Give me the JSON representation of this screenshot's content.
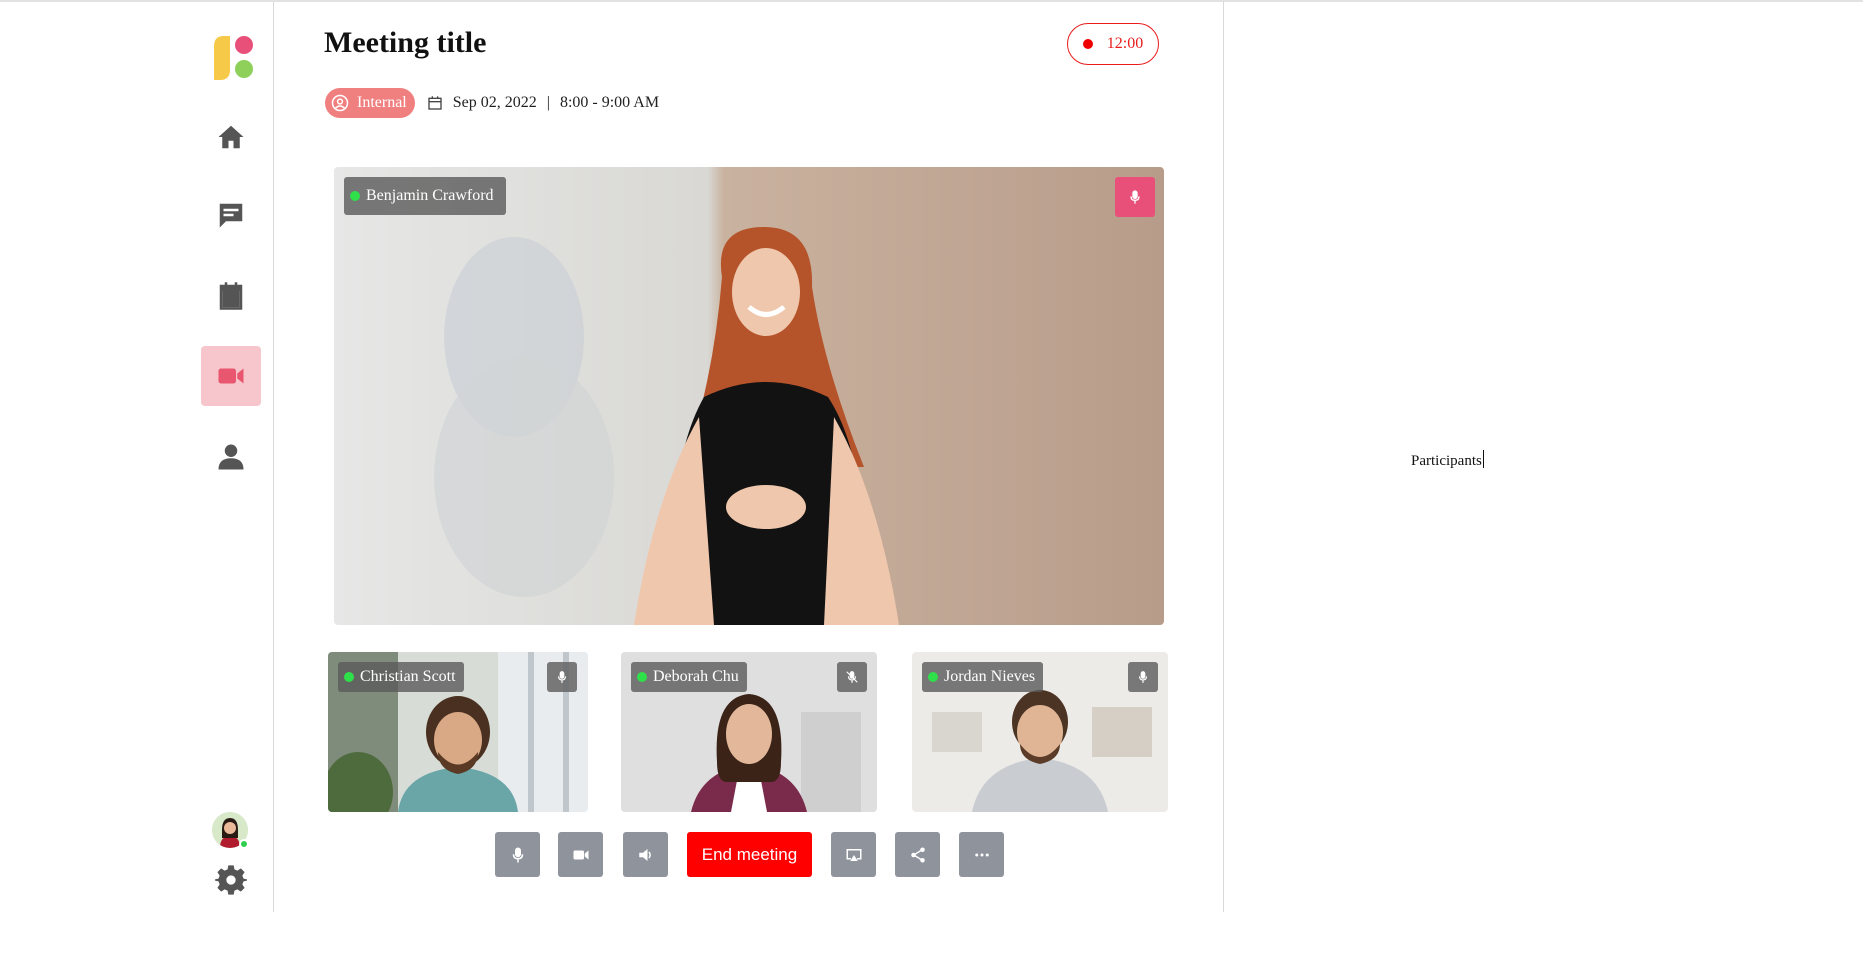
{
  "meeting": {
    "title": "Meeting title",
    "timer": "12:00",
    "badge": "Internal",
    "date": "Sep 02, 2022",
    "separator": "|",
    "time_range": "8:00 - 9:00 AM"
  },
  "sidebar": {
    "items": [
      {
        "name": "home",
        "icon": "home-icon",
        "active": false
      },
      {
        "name": "messages",
        "icon": "chat-icon",
        "active": false
      },
      {
        "name": "calendar",
        "icon": "calendar-icon",
        "active": false
      },
      {
        "name": "video",
        "icon": "video-camera-icon",
        "active": true
      },
      {
        "name": "profile",
        "icon": "person-icon",
        "active": false
      }
    ],
    "bottom": [
      "avatar",
      "gear-icon"
    ]
  },
  "main_video": {
    "speaker": "Benjamin Crawford",
    "mic": "on"
  },
  "thumbnails": [
    {
      "name": "Christian Scott",
      "mic": "on"
    },
    {
      "name": "Deborah Chu",
      "mic": "muted"
    },
    {
      "name": "Jordan Nieves",
      "mic": "on"
    }
  ],
  "controls": {
    "end_label": "End meeting",
    "buttons": [
      "mic-icon",
      "camera-icon",
      "speaker-icon",
      "screen-cast-icon",
      "share-icon",
      "more-icon"
    ]
  },
  "right_panel": {
    "label": "Participants"
  },
  "colors": {
    "accent_pink": "#e8507a",
    "nav_active_bg": "#f7c5cc",
    "end_red": "#ff0000",
    "badge_bg": "#f08080",
    "control_gray": "#8e939c",
    "online_green": "#2fe04a"
  }
}
